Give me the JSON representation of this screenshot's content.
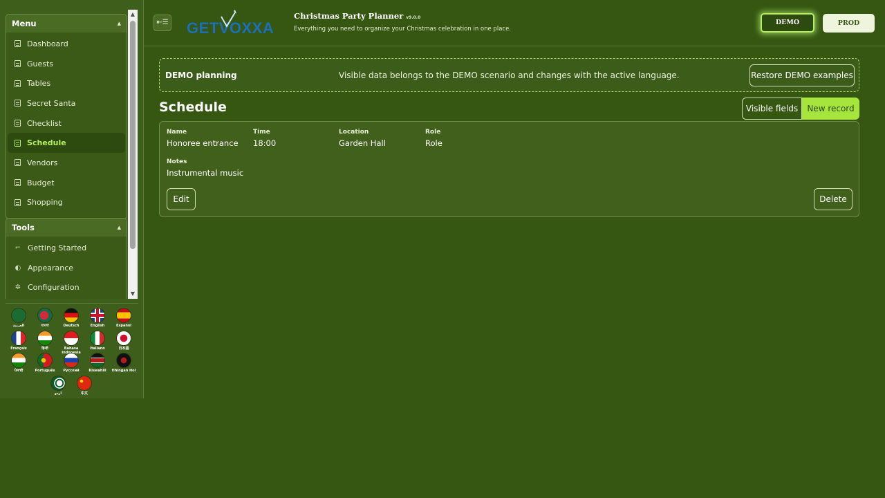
{
  "sidebar": {
    "menu_title": "Menu",
    "menu_items": [
      {
        "label": "Dashboard",
        "icon": "list-icon"
      },
      {
        "label": "Guests",
        "icon": "list-icon"
      },
      {
        "label": "Tables",
        "icon": "list-icon"
      },
      {
        "label": "Secret Santa",
        "icon": "list-icon"
      },
      {
        "label": "Checklist",
        "icon": "list-icon"
      },
      {
        "label": "Schedule",
        "icon": "list-icon",
        "active": true
      },
      {
        "label": "Vendors",
        "icon": "list-icon"
      },
      {
        "label": "Budget",
        "icon": "list-icon"
      },
      {
        "label": "Shopping",
        "icon": "list-icon"
      }
    ],
    "tools_title": "Tools",
    "tool_items": [
      {
        "label": "Getting Started",
        "icon": "crop-icon"
      },
      {
        "label": "Appearance",
        "icon": "palette-icon"
      },
      {
        "label": "Configuration",
        "icon": "gear-icon"
      }
    ],
    "languages": [
      {
        "label": "العربية",
        "flag": "saudi-arabia-flag-icon"
      },
      {
        "label": "বাংলা",
        "flag": "bangladesh-flag-icon"
      },
      {
        "label": "Deutsch",
        "flag": "germany-flag-icon"
      },
      {
        "label": "English",
        "flag": "uk-flag-icon",
        "selected": true
      },
      {
        "label": "Español",
        "flag": "spain-flag-icon"
      },
      {
        "label": "Français",
        "flag": "france-flag-icon"
      },
      {
        "label": "हिन्दी",
        "flag": "india-flag-icon"
      },
      {
        "label": "Bahasa Indonesia",
        "flag": "indonesia-flag-icon"
      },
      {
        "label": "Italiano",
        "flag": "italy-flag-icon"
      },
      {
        "label": "日本語",
        "flag": "japan-flag-icon"
      },
      {
        "label": "ਪੰਜਾਬੀ",
        "flag": "india-flag-icon"
      },
      {
        "label": "Português",
        "flag": "portugal-flag-icon"
      },
      {
        "label": "Русский",
        "flag": "russia-flag-icon"
      },
      {
        "label": "Kiswahili",
        "flag": "kenya-flag-icon"
      },
      {
        "label": "tlhIngan Hol",
        "flag": "klingon-flag-icon"
      },
      {
        "label": "اردو",
        "flag": "pakistan-flag-icon"
      },
      {
        "label": "中文",
        "flag": "china-flag-icon"
      }
    ]
  },
  "header": {
    "logo_text": "GETVOXXA",
    "title": "Christmas Party Planner",
    "version": "v9.0.0",
    "subtitle": "Everything you need to organize your Christmas celebration in one place.",
    "env_demo": "DEMO",
    "env_prod": "PROD"
  },
  "banner": {
    "title": "DEMO planning",
    "text": "Visible data belongs to the DEMO scenario and changes with the active language.",
    "restore_label": "Restore DEMO examples"
  },
  "schedule": {
    "title": "Schedule",
    "visible_fields_label": "Visible fields",
    "new_record_label": "New record",
    "record": {
      "name_label": "Name",
      "name_value": "Honoree entrance",
      "time_label": "Time",
      "time_value": "18:00",
      "location_label": "Location",
      "location_value": "Garden Hall",
      "role_label": "Role",
      "role_value": "Role",
      "notes_label": "Notes",
      "notes_value": "Instrumental music"
    },
    "edit_label": "Edit",
    "delete_label": "Delete"
  },
  "colors": {
    "background": "#355711",
    "accent": "#a6e53c",
    "active_text": "#b8f05c"
  }
}
